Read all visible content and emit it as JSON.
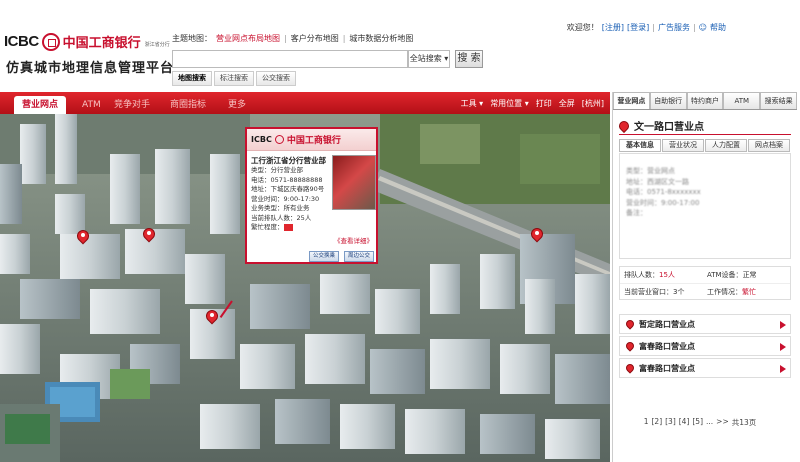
{
  "header": {
    "brand_en": "ICBC",
    "brand_cn": "中国工商银行",
    "branch_note": "浙江省分行",
    "system_title": "仿真城市地理信息管理平台",
    "top_links": {
      "welcome": "欢迎您！",
      "register": "[注册]",
      "login": "[登录]",
      "ad_service": "广告服务",
      "help": "帮助"
    },
    "theme_label": "主题地图：",
    "themes": [
      "营业网点布局地图",
      "客户分布地图",
      "城市数据分析地图"
    ],
    "search": {
      "value": "",
      "scope": "全站搜索",
      "button": "搜 索"
    },
    "sub_tabs": [
      "地图搜索",
      "标注搜索",
      "公交搜索"
    ]
  },
  "menubar": {
    "tabs": [
      "营业网点",
      "ATM",
      "竞争对手",
      "商圈指标",
      "更多"
    ],
    "toolbar": [
      "工具 ▾",
      "常用位置 ▾",
      "打印",
      "全屏",
      "[杭州]"
    ]
  },
  "popup": {
    "brand_cn": "中国工商银行",
    "brand_en": "ICBC",
    "title": "工行浙江省分行营业部",
    "info": [
      "类型：分行营业部",
      "电话：0571-88888888",
      "地址：下城区庆春路90号",
      "营业时间：9:00-17:30",
      "业务类型：所有业务",
      "当前排队人数：25人"
    ],
    "busy_label": "繁忙程度：",
    "detail_link": "《查看详细》",
    "btn_bus": "公交换乘",
    "btn_around": "周边公交"
  },
  "panel": {
    "tabs": [
      "营业网点",
      "自助银行",
      "特约商户",
      "ATM",
      "搜索结果"
    ],
    "outlet_title": "文一路口营业点",
    "detail_tabs": [
      "基本信息",
      "营业状况",
      "人力配置",
      "网点档案"
    ],
    "basic_info": [
      "类型：营业网点",
      "地址：西湖区文一路",
      "电话：0571-8xxxxxxx",
      "营业时间：9:00-17:00",
      "备注："
    ],
    "stats": {
      "queue_label": "排队人数：",
      "queue_value": "15人",
      "atm_label": "ATM设备：",
      "atm_value": "正常",
      "window_label": "当前营业窗口：",
      "window_value": "3个",
      "work_label": "工作情况：",
      "work_value": "繁忙"
    },
    "outlets": [
      "暂定路口营业点",
      "富春路口营业点",
      "富春路口营业点"
    ],
    "pager": [
      "1",
      "[2]",
      "[3]",
      "[4]",
      "[5]",
      "...",
      ">>",
      "共13页"
    ]
  },
  "colors": {
    "accent": "#c8102e",
    "menubar": "#d11a22",
    "link": "#1a5fb4"
  },
  "map": {
    "markers": 5
  }
}
